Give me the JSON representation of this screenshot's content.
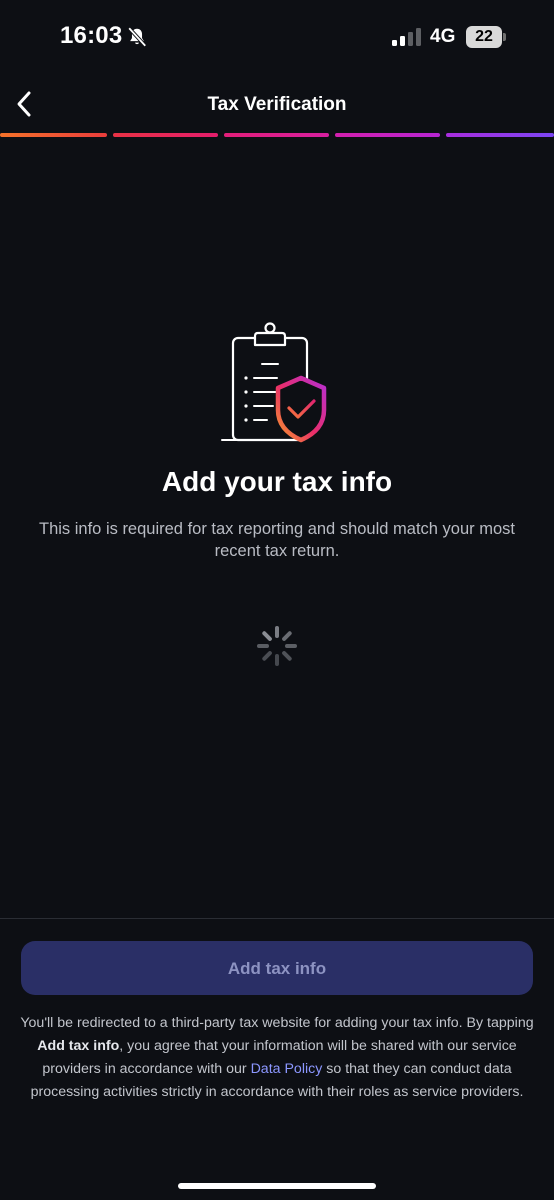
{
  "status_bar": {
    "time": "16:03",
    "network": "4G",
    "battery": "22",
    "icons": [
      "bell-slash-icon",
      "signal-icon",
      "battery-icon"
    ]
  },
  "header": {
    "title": "Tax Verification",
    "back_icon": "chevron-left-icon",
    "progress_colors": [
      "#f0602a",
      "#e61e63",
      "#e0208c",
      "#c61fc8",
      "#8a3cf0"
    ]
  },
  "main": {
    "illustration_icon": "clipboard-shield-check-icon",
    "title": "Add your tax info",
    "description": "This info is required for tax reporting and should match your most recent tax return.",
    "loading_icon": "spinner-icon"
  },
  "footer": {
    "button_label": "Add tax info",
    "disclaimer_1": "You'll be redirected to a third-party tax website for adding your tax info. By tapping ",
    "disclaimer_bold": "Add tax info",
    "disclaimer_2": ", you agree that your information will be shared with our service providers in accordance with our ",
    "data_policy_link": "Data Policy",
    "disclaimer_3": " so that they can conduct data processing activities strictly in accordance with their roles as service providers."
  },
  "colors": {
    "background": "#0d0f14",
    "button_bg": "#2a2f66",
    "button_text": "#8d93c2",
    "link": "#8c97ff"
  }
}
